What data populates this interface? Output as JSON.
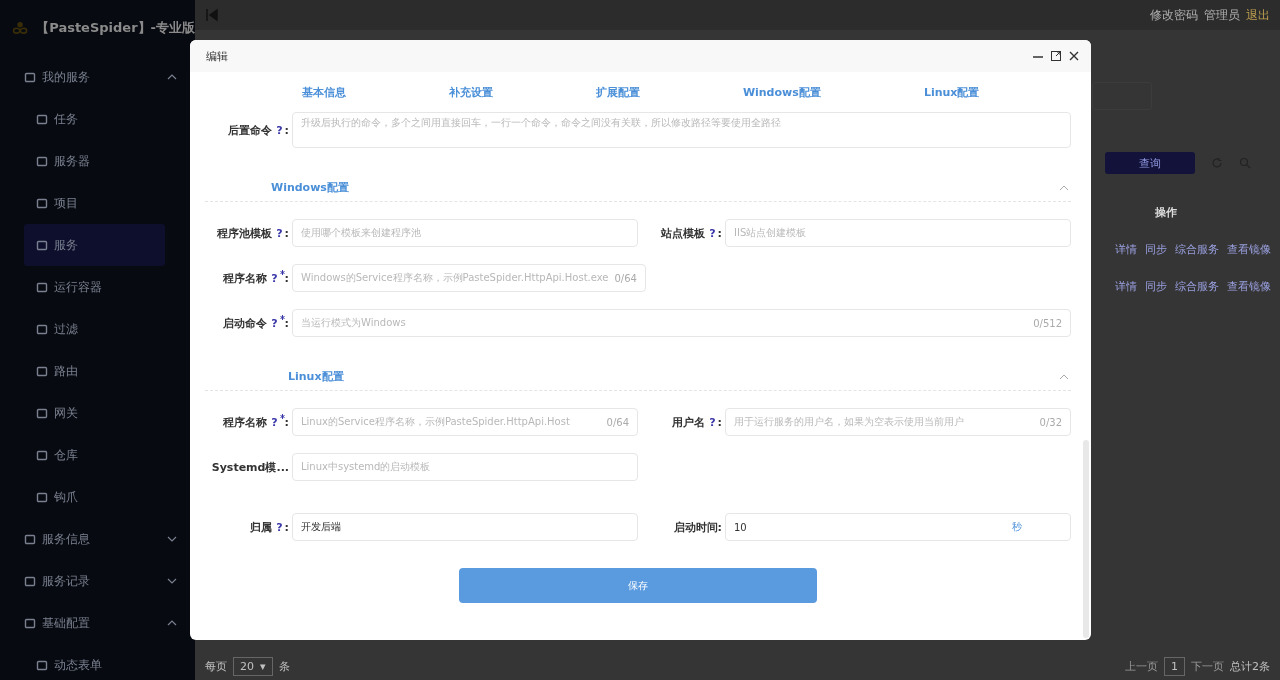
{
  "app": {
    "title": "【PasteSpider】-专业版"
  },
  "header": {
    "links": [
      {
        "label": "修改密码",
        "kind": "normal"
      },
      {
        "label": "管理员",
        "kind": "normal"
      },
      {
        "label": "退出",
        "kind": "warn"
      }
    ]
  },
  "sidebar": {
    "groups": [
      {
        "label": "我的服务",
        "expanded": true,
        "children": [
          {
            "label": "任务",
            "selected": false
          },
          {
            "label": "服务器",
            "selected": false
          },
          {
            "label": "项目",
            "selected": false
          },
          {
            "label": "服务",
            "selected": true
          },
          {
            "label": "运行容器",
            "selected": false
          },
          {
            "label": "过滤",
            "selected": false
          },
          {
            "label": "路由",
            "selected": false
          },
          {
            "label": "网关",
            "selected": false
          },
          {
            "label": "仓库",
            "selected": false
          },
          {
            "label": "钩爪",
            "selected": false
          }
        ]
      },
      {
        "label": "服务信息",
        "expanded": false
      },
      {
        "label": "服务记录",
        "expanded": false
      },
      {
        "label": "基础配置",
        "expanded": true,
        "children": [
          {
            "label": "动态表单",
            "selected": false
          }
        ]
      }
    ]
  },
  "page": {
    "query_button": "查询",
    "table": {
      "column_header": "操作",
      "rows": [
        [
          "详情",
          "同步",
          "综合服务",
          "查看镜像"
        ],
        [
          "详情",
          "同步",
          "综合服务",
          "查看镜像"
        ]
      ]
    },
    "pagination": {
      "per_page_label": "每页",
      "per_page": "20",
      "per_page_caret": "▾",
      "per_page_unit": "条",
      "prev": "上一页",
      "page": "1",
      "next": "下一页",
      "total": "总计2条"
    }
  },
  "dialog": {
    "title": "编辑",
    "tabs": [
      {
        "label": "基本信息",
        "selected": false
      },
      {
        "label": "补充设置",
        "selected": false
      },
      {
        "label": "扩展配置",
        "selected": false
      },
      {
        "label": "Windows配置",
        "selected": false
      },
      {
        "label": "Linux配置",
        "selected": false
      }
    ],
    "top_field": {
      "label": "后置命令",
      "help": "?",
      "colon": ":",
      "placeholder": "升级后执行的命令，多个之间用直接回车，一行一个命令，命令之间没有关联，所以修改路径等要使用全路径"
    },
    "sections": [
      {
        "title": "Windows配置",
        "expanded": true,
        "rows": [
          [
            {
              "label": "程序池模板",
              "help": "?",
              "colon": ":",
              "required": false,
              "placeholder": "使用哪个模板来创建程序池"
            },
            {
              "label": "站点模板",
              "help": "?",
              "colon": ":",
              "required": false,
              "placeholder": "IIS站点创建模板"
            }
          ],
          [
            {
              "label": "程序名称",
              "help": "?",
              "colon": ":",
              "required": true,
              "placeholder": "Windows的Service程序名称，示例PasteSpider.HttpApi.Host.exe",
              "count": "0/64"
            }
          ],
          [
            {
              "label": "启动命令",
              "help": "?",
              "colon": ":",
              "required": true,
              "placeholder": "当运行模式为Windows",
              "count": "0/512",
              "wide": true
            }
          ]
        ]
      },
      {
        "title": "Linux配置",
        "expanded": true,
        "rows": [
          [
            {
              "label": "程序名称",
              "help": "?",
              "colon": ":",
              "required": true,
              "placeholder": "Linux的Service程序名称，示例PasteSpider.HttpApi.Host",
              "count": "0/64"
            },
            {
              "label": "用户名",
              "help": "?",
              "colon": ":",
              "required": false,
              "placeholder": "用于运行服务的用户名，如果为空表示使用当前用户",
              "count": "0/32"
            }
          ],
          [
            {
              "label": "Systemd模...",
              "required": false,
              "placeholder": "Linux中systemd的启动模板"
            }
          ]
        ]
      }
    ],
    "bottom_row": [
      {
        "label": "归属",
        "help": "?",
        "colon": ":",
        "required": false,
        "value": "开发后端"
      },
      {
        "label": "启动时间",
        "colon": ":",
        "required": false,
        "value": "10",
        "suffix": "秒"
      }
    ],
    "save_button": "保存"
  }
}
